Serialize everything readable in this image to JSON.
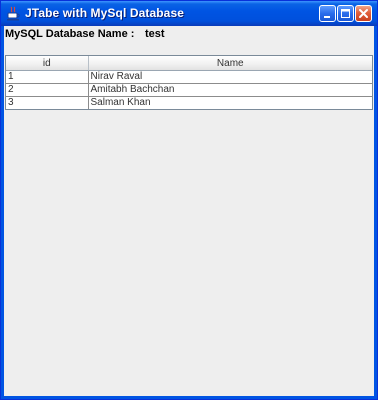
{
  "window": {
    "title": "JTabe with MySql Database"
  },
  "database": {
    "label": "MySQL Database Name :",
    "value": "test"
  },
  "table": {
    "columns": [
      "id",
      "Name"
    ],
    "rows": [
      [
        "1",
        "Nirav Raval"
      ],
      [
        "2",
        "Amitabh Bachchan"
      ],
      [
        "3",
        "Salman Khan"
      ]
    ]
  },
  "colors": {
    "titlebar": "#0054E3",
    "client_background": "#EEEEEE",
    "close_button": "#E2603C"
  },
  "icons": {
    "app": "java-cup-icon",
    "minimize": "minimize-icon",
    "maximize": "maximize-icon",
    "close": "close-icon"
  }
}
